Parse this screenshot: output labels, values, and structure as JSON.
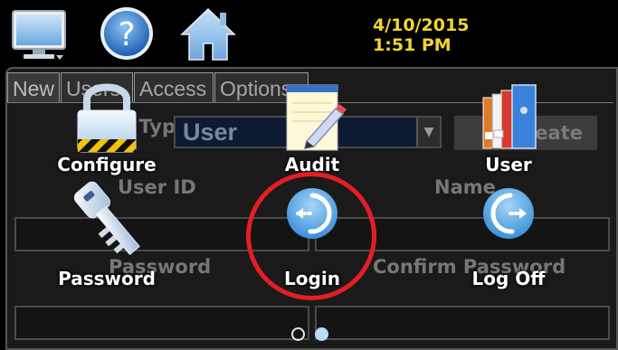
{
  "status_bar": {
    "date": "4/10/2015",
    "time": "1:51 PM",
    "icons": [
      "monitor-icon",
      "help-icon",
      "home-icon"
    ]
  },
  "background_form": {
    "tabs": [
      "New",
      "Users",
      "Access",
      "Options"
    ],
    "user_type_label": "User Type",
    "user_type_value": "User",
    "create_button_label": "Create",
    "user_id_label": "User ID",
    "name_label": "Name",
    "password_label": "Password",
    "confirm_password_label": "Confirm Password"
  },
  "launcher": {
    "items": [
      {
        "label": "Configure",
        "icon": "padlock-icon"
      },
      {
        "label": "Audit",
        "icon": "notepad-pencil-icon"
      },
      {
        "label": "User",
        "icon": "binders-icon"
      },
      {
        "label": "Password",
        "icon": "key-icon"
      },
      {
        "label": "Login",
        "icon": "login-arrow-icon"
      },
      {
        "label": "Log Off",
        "icon": "logoff-arrow-icon"
      }
    ],
    "highlighted_item": "Login",
    "highlight_color": "#e31e24"
  },
  "pager": {
    "page_count": 2,
    "current_page": 2
  },
  "colors": {
    "datetime": "#f2d62a",
    "accent_blue": "#3a8fd8",
    "background": "#000000"
  }
}
